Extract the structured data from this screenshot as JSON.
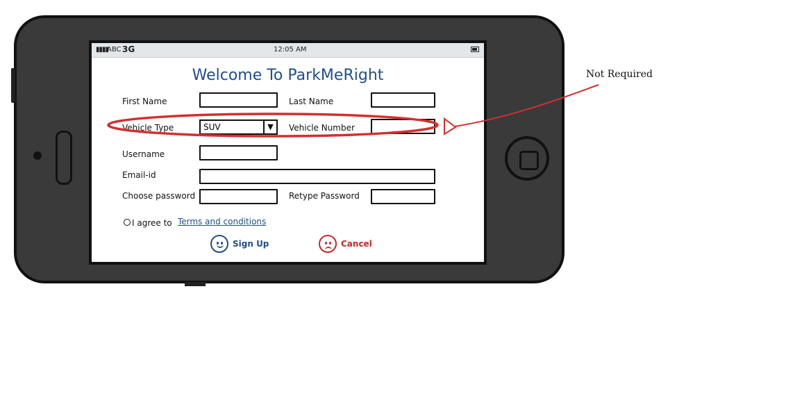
{
  "status_bar": {
    "carrier": "ABC",
    "network": "3G",
    "time": "12:05 AM"
  },
  "form": {
    "title": "Welcome To ParkMeRight",
    "first_name_label": "First Name",
    "last_name_label": "Last Name",
    "vehicle_type_label": "Vehicle Type",
    "vehicle_type_value": "SUV",
    "vehicle_number_label": "Vehicle Number",
    "username_label": "Username",
    "email_label": "Email-id",
    "choose_password_label": "Choose password",
    "retype_password_label": "Retype Password",
    "agree_text": "I agree to",
    "terms_link": "Terms and conditions",
    "signup_label": "Sign Up",
    "cancel_label": "Cancel"
  },
  "annotation": {
    "note": "Not Required"
  },
  "colors": {
    "accent": "#1f4e8c",
    "cancel": "#c62828",
    "annotation": "#d32f2f",
    "phone_body": "#3a3a3a"
  }
}
